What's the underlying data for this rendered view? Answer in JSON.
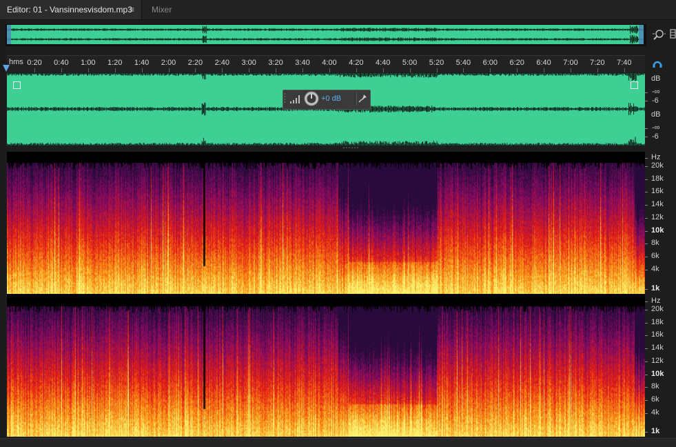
{
  "tabs": {
    "editor_label": "Editor: 01 - Vansinnesvisdom.mp3",
    "menu_glyph": "≡",
    "mixer_label": "Mixer"
  },
  "ruler": {
    "unit_label": "hms",
    "ticks": [
      "0:20",
      "0:40",
      "1:00",
      "1:20",
      "1:40",
      "2:00",
      "2:20",
      "2:40",
      "3:00",
      "3:20",
      "3:40",
      "4:00",
      "4:20",
      "4:40",
      "5:00",
      "5:20",
      "5:40",
      "6:00",
      "6:20",
      "6:40",
      "7:00",
      "7:20",
      "7:40"
    ]
  },
  "hud": {
    "gain": "+0 dB"
  },
  "db_scale": {
    "channel_1": [
      "dB",
      "-∞",
      "-6"
    ],
    "channel_2": [
      "dB",
      "-∞",
      "-6"
    ]
  },
  "freq_scale": {
    "channel_1": [
      "Hz",
      "20k",
      "18k",
      "16k",
      "14k",
      "12k",
      "10k",
      "8k",
      "6k",
      "4k",
      "1k"
    ],
    "channel_2": [
      "Hz",
      "20k",
      "18k",
      "16k",
      "14k",
      "12k",
      "10k",
      "8k",
      "6k",
      "4k",
      "1k"
    ]
  },
  "icons": {
    "zoom": "zoom-icon",
    "loop": "loop-icon",
    "pin": "pin-icon",
    "knob": "volume-knob-icon",
    "level": "level-bars-icon"
  },
  "colors": {
    "waveform_bg": "#3ecf95",
    "accent_blue": "#5fa3e0",
    "spectral_low": "#fce96a",
    "spectral_mid": "#e2301a",
    "spectral_high": "#4a1a6a"
  }
}
